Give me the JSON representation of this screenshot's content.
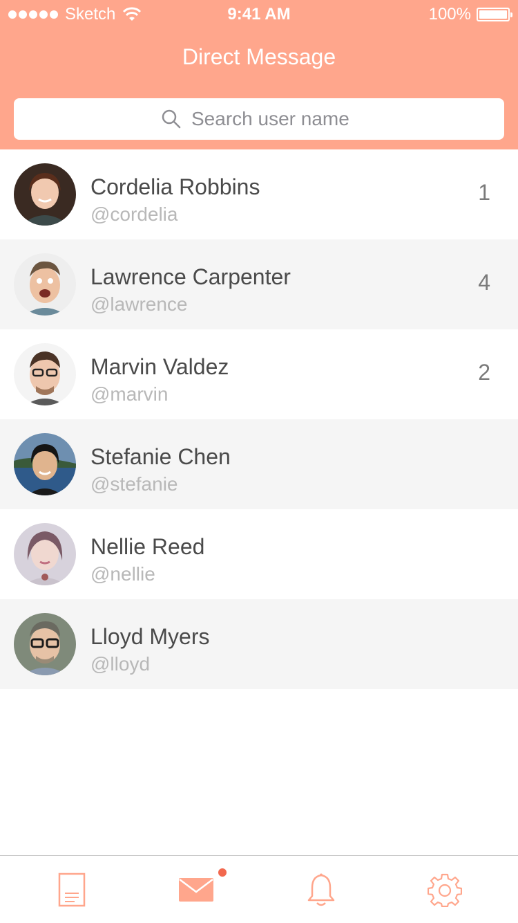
{
  "status_bar": {
    "carrier": "Sketch",
    "time": "9:41 AM",
    "battery": "100%"
  },
  "header": {
    "title": "Direct Message"
  },
  "search": {
    "placeholder": "Search user name"
  },
  "colors": {
    "accent": "#FFA68C",
    "badge": "#F2684E",
    "row_alt": "#F5F5F5"
  },
  "contacts": [
    {
      "name": "Cordelia Robbins",
      "handle": "@cordelia",
      "unread": "1"
    },
    {
      "name": "Lawrence Carpenter",
      "handle": "@lawrence",
      "unread": "4"
    },
    {
      "name": "Marvin Valdez",
      "handle": "@marvin",
      "unread": "2"
    },
    {
      "name": "Stefanie Chen",
      "handle": "@stefanie",
      "unread": ""
    },
    {
      "name": "Nellie Reed",
      "handle": "@nellie",
      "unread": ""
    },
    {
      "name": "Lloyd Myers",
      "handle": "@lloyd",
      "unread": ""
    }
  ],
  "tabbar": {
    "tabs": [
      {
        "icon": "document-icon",
        "active": false
      },
      {
        "icon": "mail-icon",
        "active": true,
        "has_badge": true
      },
      {
        "icon": "bell-icon",
        "active": false
      },
      {
        "icon": "gear-icon",
        "active": false
      }
    ]
  }
}
